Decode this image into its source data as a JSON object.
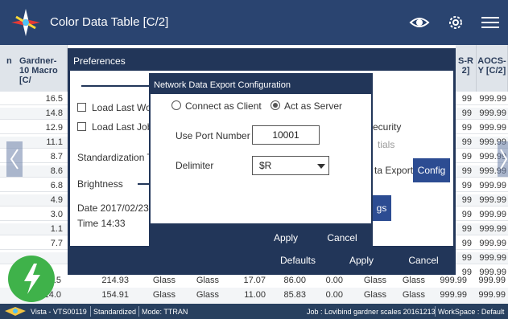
{
  "app": {
    "title": "Color Data Table [C/2]"
  },
  "table": {
    "header_left": "Gardner-10 Macro [C/",
    "header_left_prefix": "n",
    "header_r1": "S-R 2]",
    "header_r2": "AOCS-Y [C/2]",
    "left_values": [
      "16.5",
      "14.8",
      "12.9",
      "11.1",
      "8.7",
      "8.6",
      "6.8",
      "4.9",
      "3.0",
      "1.1",
      "7.7"
    ],
    "r1_value": "99",
    "r2_value": "999.99"
  },
  "preferences": {
    "title": "Preferences",
    "load_last_wor": "Load Last Wor",
    "load_last_job": "Load Last Job",
    "standardization": "Standardization Ti",
    "brightness": "Brightness",
    "date": "Date  2017/02/23",
    "time": "Time  14:33",
    "security": "ecurity",
    "tials": "tials",
    "data_export": "ta Export",
    "config": "Config",
    "gs": "gs",
    "defaults": "Defaults",
    "apply": "Apply",
    "cancel": "Cancel"
  },
  "network": {
    "title": "Network Data Export Configuration",
    "connect_client": "Connect as Client",
    "act_server": "Act as Server",
    "port_label": "Use Port Number",
    "port_value": "10001",
    "delimiter_label": "Delimiter",
    "delimiter_value": "$R",
    "apply": "Apply",
    "cancel": "Cancel"
  },
  "bottom_rows": [
    {
      "c0": "15.5",
      "c1": "214.93",
      "c2": "Glass",
      "c3": "Glass",
      "c4": "17.07",
      "c5": "86.00",
      "c6": "0.00",
      "c7": "Glass",
      "c8": "Glass",
      "c9": "999.99",
      "c10": "999.99"
    },
    {
      "c0": "14.0",
      "c1": "154.91",
      "c2": "Glass",
      "c3": "Glass",
      "c4": "11.00",
      "c5": "85.83",
      "c6": "0.00",
      "c7": "Glass",
      "c8": "Glass",
      "c9": "999.99",
      "c10": "999.99"
    }
  ],
  "status": {
    "instrument": "Vista - VTS00119",
    "mode_std": "Standardized",
    "mode": "Mode: TTRAN",
    "job": "Job : Lovibind gardner scales 20161213",
    "workspace": "WorkSpace : Default"
  }
}
